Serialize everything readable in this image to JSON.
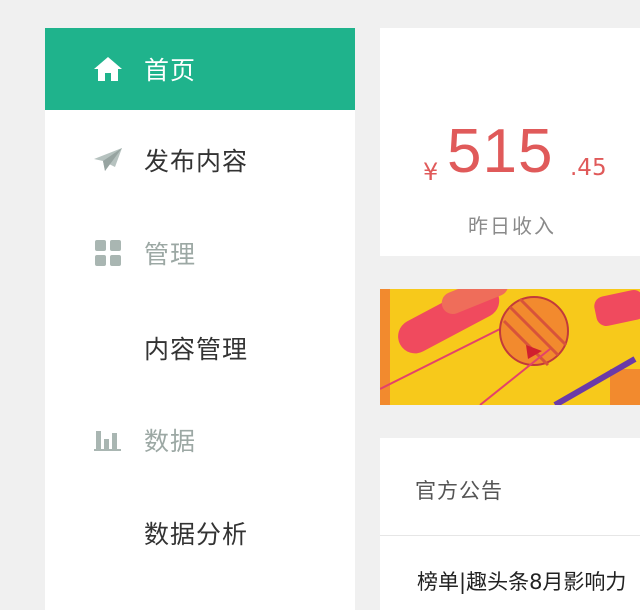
{
  "sidebar": {
    "items": [
      {
        "label": "首页",
        "icon": "home-icon",
        "active": true
      },
      {
        "label": "发布内容",
        "icon": "paper-plane-icon"
      },
      {
        "label": "管理",
        "icon": "grid-icon",
        "section": true
      },
      {
        "label": "内容管理"
      },
      {
        "label": "数据",
        "icon": "bar-chart-icon",
        "section": true
      },
      {
        "label": "数据分析"
      }
    ]
  },
  "income": {
    "currency": "¥",
    "amount": "515",
    "cents": ".45",
    "label": "昨日收入"
  },
  "notice": {
    "title": "官方公告",
    "items": [
      "榜单|趣头条8月影响力"
    ]
  },
  "colors": {
    "accent": "#1fb38c",
    "income": "#e05a5a",
    "muted": "#9ca8a4"
  }
}
